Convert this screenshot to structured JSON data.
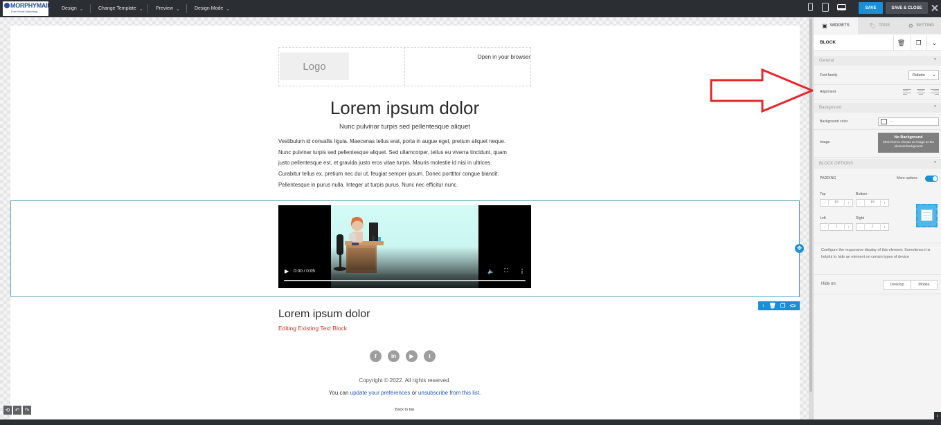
{
  "app": {
    "brand": "MORPHYMAIL",
    "brand_tagline": "Free Email Marketing"
  },
  "topbar": {
    "menus": [
      {
        "label": "Design"
      },
      {
        "label": "Change Template"
      },
      {
        "label": "Preview"
      },
      {
        "label": "Design Mode"
      }
    ],
    "save_label": "SAVE",
    "save_close_label": "SAVE & CLOSE"
  },
  "email": {
    "logo_placeholder": "Logo",
    "open_in_browser": "Open in your browser",
    "headline": "Lorem ipsum dolor",
    "subhead": "Nunc pulvinar turpis sed pellentesque aliquet",
    "body_lines": [
      "Vestibulum id convallis ligula. Maecenas tellus erat, porta in augue eget, pretium aliquet neque.",
      "Nunc pulvinar turpis sed pellentesque aliquet. Sed ullamcorper, tellus eu viverra tincidunt, quam",
      "justo pellentesque est, et gravida justo eros vitae turpis. Mauris molestie id nisi in ultrices.",
      "Curabitur tellus ex, pretium nec dui ut, feugiat semper ipsum. Donec porttitor congue blandit.",
      "Pellentesque in purus nulla. Integer ut turpis purus. Nunc nec efficitur nunc."
    ],
    "video": {
      "time": "0:00 / 0:05",
      "progress": 0
    },
    "heading2": "Lorem ipsum dolor",
    "editing_note": "Editing Existing Text Block",
    "social": [
      "f",
      "in",
      "▶",
      "t"
    ],
    "copyright": "Copyright © 2022. All rights reserved.",
    "prefs_prefix": "You can",
    "prefs_link": "update your preferences",
    "prefs_or": "or",
    "unsubscribe_link": "unsubscribe from this list",
    "prefs_suffix": ".",
    "back_to_top": "Back to top"
  },
  "panel": {
    "tabs": [
      {
        "label": "WIDGETS",
        "active": true
      },
      {
        "label": "TAGS",
        "active": false
      },
      {
        "label": "SETTING",
        "active": false
      }
    ],
    "block_title": "BLOCK",
    "general": {
      "header": "General",
      "font_family_label": "Font family",
      "font_family_value": "Roboto",
      "alignment_label": "Alignment"
    },
    "background": {
      "header": "Background",
      "color_label": "Background color",
      "color_value": "--",
      "image_label": "Image",
      "no_bg_title": "No Background",
      "no_bg_hint": "Click here to choose an image as the element background"
    },
    "block_options": {
      "header": "BLOCK OPTIONS",
      "padding_label": "PADDING",
      "more_options": "More options",
      "more_options_enabled": true,
      "top_label": "Top",
      "bottom_label": "Bottom",
      "left_label": "Left",
      "right_label": "Right",
      "top": "15",
      "bottom": "15",
      "left": "1",
      "right": "1",
      "responsive_note": "Configure the responsive display of this element. Sometimes it is helpful to hide an element on certain types of device",
      "hide_on_label": "Hide on",
      "hide_desktop": "Desktop",
      "hide_mobile": "Mobile"
    }
  },
  "colors": {
    "accent": "#1a8fd6",
    "topbar": "#2b2e33",
    "annotation": "#e8242a",
    "editing_note": "#c0392b",
    "link": "#2456b8"
  }
}
